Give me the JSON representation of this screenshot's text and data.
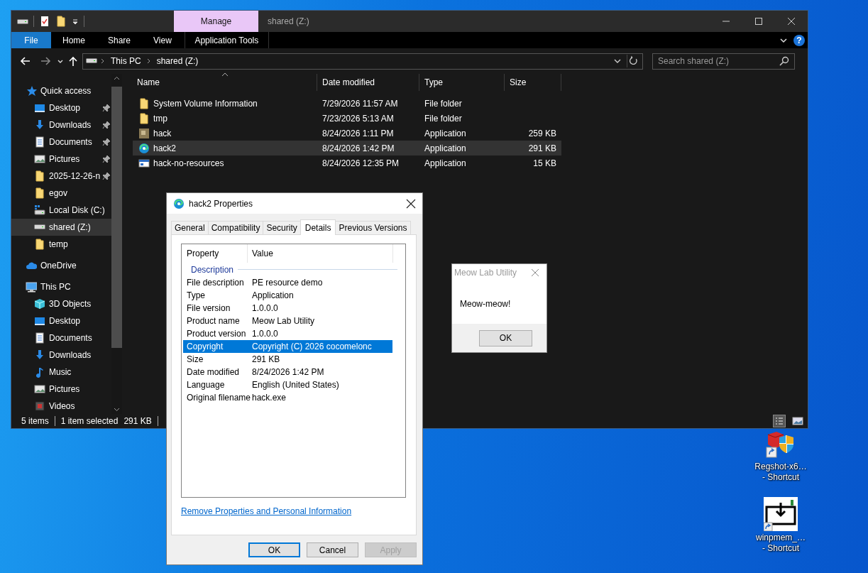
{
  "explorer": {
    "title": "shared (Z:)",
    "contextual_group": "Manage",
    "ribbon_tabs": [
      {
        "label": "File",
        "kind": "file"
      },
      {
        "label": "Home",
        "kind": "tab"
      },
      {
        "label": "Share",
        "kind": "tab"
      },
      {
        "label": "View",
        "kind": "tab"
      },
      {
        "label": "Application Tools",
        "kind": "contextual"
      }
    ],
    "help_button": "?",
    "address": {
      "crumbs": [
        "This PC",
        "shared (Z:)"
      ]
    },
    "search": {
      "placeholder": "Search shared (Z:)"
    },
    "sidebar": {
      "items": [
        {
          "label": "Quick access",
          "kind": "star",
          "selected": false,
          "children": [
            {
              "label": "Desktop",
              "kind": "desktop",
              "pinned": true,
              "selected": false
            },
            {
              "label": "Downloads",
              "kind": "downloads",
              "pinned": true,
              "selected": false
            },
            {
              "label": "Documents",
              "kind": "documents",
              "pinned": true,
              "selected": false
            },
            {
              "label": "Pictures",
              "kind": "pictures",
              "pinned": true,
              "selected": false
            },
            {
              "label": "2025-12-26-n",
              "kind": "folder",
              "pinned": true,
              "selected": false
            },
            {
              "label": "egov",
              "kind": "folder",
              "pinned": false,
              "selected": false
            },
            {
              "label": "Local Disk (C:)",
              "kind": "localdisk",
              "pinned": false,
              "selected": false
            },
            {
              "label": "shared (Z:)",
              "kind": "drive",
              "pinned": false,
              "selected": true
            },
            {
              "label": "temp",
              "kind": "folder",
              "pinned": false,
              "selected": false
            }
          ]
        },
        {
          "label": "OneDrive",
          "kind": "cloud",
          "selected": false
        },
        {
          "label": "This PC",
          "kind": "pc",
          "selected": false,
          "children": [
            {
              "label": "3D Objects",
              "kind": "objects3d",
              "selected": false
            },
            {
              "label": "Desktop",
              "kind": "desktop",
              "selected": false
            },
            {
              "label": "Documents",
              "kind": "documents",
              "selected": false
            },
            {
              "label": "Downloads",
              "kind": "downloads",
              "selected": false
            },
            {
              "label": "Music",
              "kind": "music",
              "selected": false
            },
            {
              "label": "Pictures",
              "kind": "pictures",
              "selected": false
            },
            {
              "label": "Videos",
              "kind": "videos",
              "selected": false
            }
          ]
        }
      ]
    },
    "columns": [
      "Name",
      "Date modified",
      "Type",
      "Size"
    ],
    "files": [
      {
        "name": "System Volume Information",
        "date": "7/29/2026 11:57 AM",
        "type": "File folder",
        "kind": "folder",
        "selected": false
      },
      {
        "name": "tmp",
        "date": "7/23/2026 5:13 AM",
        "type": "File folder",
        "kind": "folder",
        "selected": false
      },
      {
        "name": "hack",
        "date": "8/24/2026 1:11 PM",
        "type": "Application",
        "size": "259 KB",
        "kind": "image",
        "selected": false
      },
      {
        "name": "hack2",
        "date": "8/24/2026 1:42 PM",
        "type": "Application",
        "size": "291 KB",
        "kind": "swirl",
        "selected": true
      },
      {
        "name": "hack-no-resources",
        "date": "8/24/2026 12:35 PM",
        "type": "Application",
        "size": "15 KB",
        "kind": "window",
        "selected": false
      }
    ],
    "status_bar": {
      "count": "5 items",
      "selection": "1 item selected",
      "selection_size": "291 KB"
    }
  },
  "properties_dialog": {
    "title": "hack2 Properties",
    "active": true,
    "tabs": [
      {
        "label": "General",
        "selected": false
      },
      {
        "label": "Compatibility",
        "selected": false
      },
      {
        "label": "Security",
        "selected": false
      },
      {
        "label": "Details",
        "selected": true
      },
      {
        "label": "Previous Versions",
        "selected": false
      }
    ],
    "columns": [
      "Property",
      "Value"
    ],
    "group": "Description",
    "rows": [
      {
        "property": "File description",
        "value": "PE resource demo",
        "selected": false
      },
      {
        "property": "Type",
        "value": "Application",
        "selected": false
      },
      {
        "property": "File version",
        "value": "1.0.0.0",
        "selected": false
      },
      {
        "property": "Product name",
        "value": "Meow Lab Utility",
        "selected": false
      },
      {
        "property": "Product version",
        "value": "1.0.0.0",
        "selected": false
      },
      {
        "property": "Copyright",
        "value": "Copyright (C) 2026 cocomelonc",
        "selected": true
      },
      {
        "property": "Size",
        "value": "291 KB",
        "selected": false
      },
      {
        "property": "Date modified",
        "value": "8/24/2026 1:42 PM",
        "selected": false
      },
      {
        "property": "Language",
        "value": "English (United States)",
        "selected": false
      },
      {
        "property": "Original filename",
        "value": "hack.exe",
        "selected": false
      }
    ],
    "link": "Remove Properties and Personal Information",
    "buttons": [
      {
        "label": "OK",
        "default": true,
        "disabled": false
      },
      {
        "label": "Cancel",
        "default": false,
        "disabled": false
      },
      {
        "label": "Apply",
        "default": false,
        "disabled": true
      }
    ]
  },
  "message_box": {
    "title": "Meow Lab Utility",
    "active": false,
    "message": "Meow-meow!",
    "button": "OK"
  },
  "desktop_icons": [
    {
      "kind": "regshot",
      "lines": [
        "Regshot-x6…",
        "- Shortcut"
      ]
    },
    {
      "kind": "winpmem",
      "lines": [
        "winpmem_…",
        "- Shortcut"
      ]
    }
  ]
}
